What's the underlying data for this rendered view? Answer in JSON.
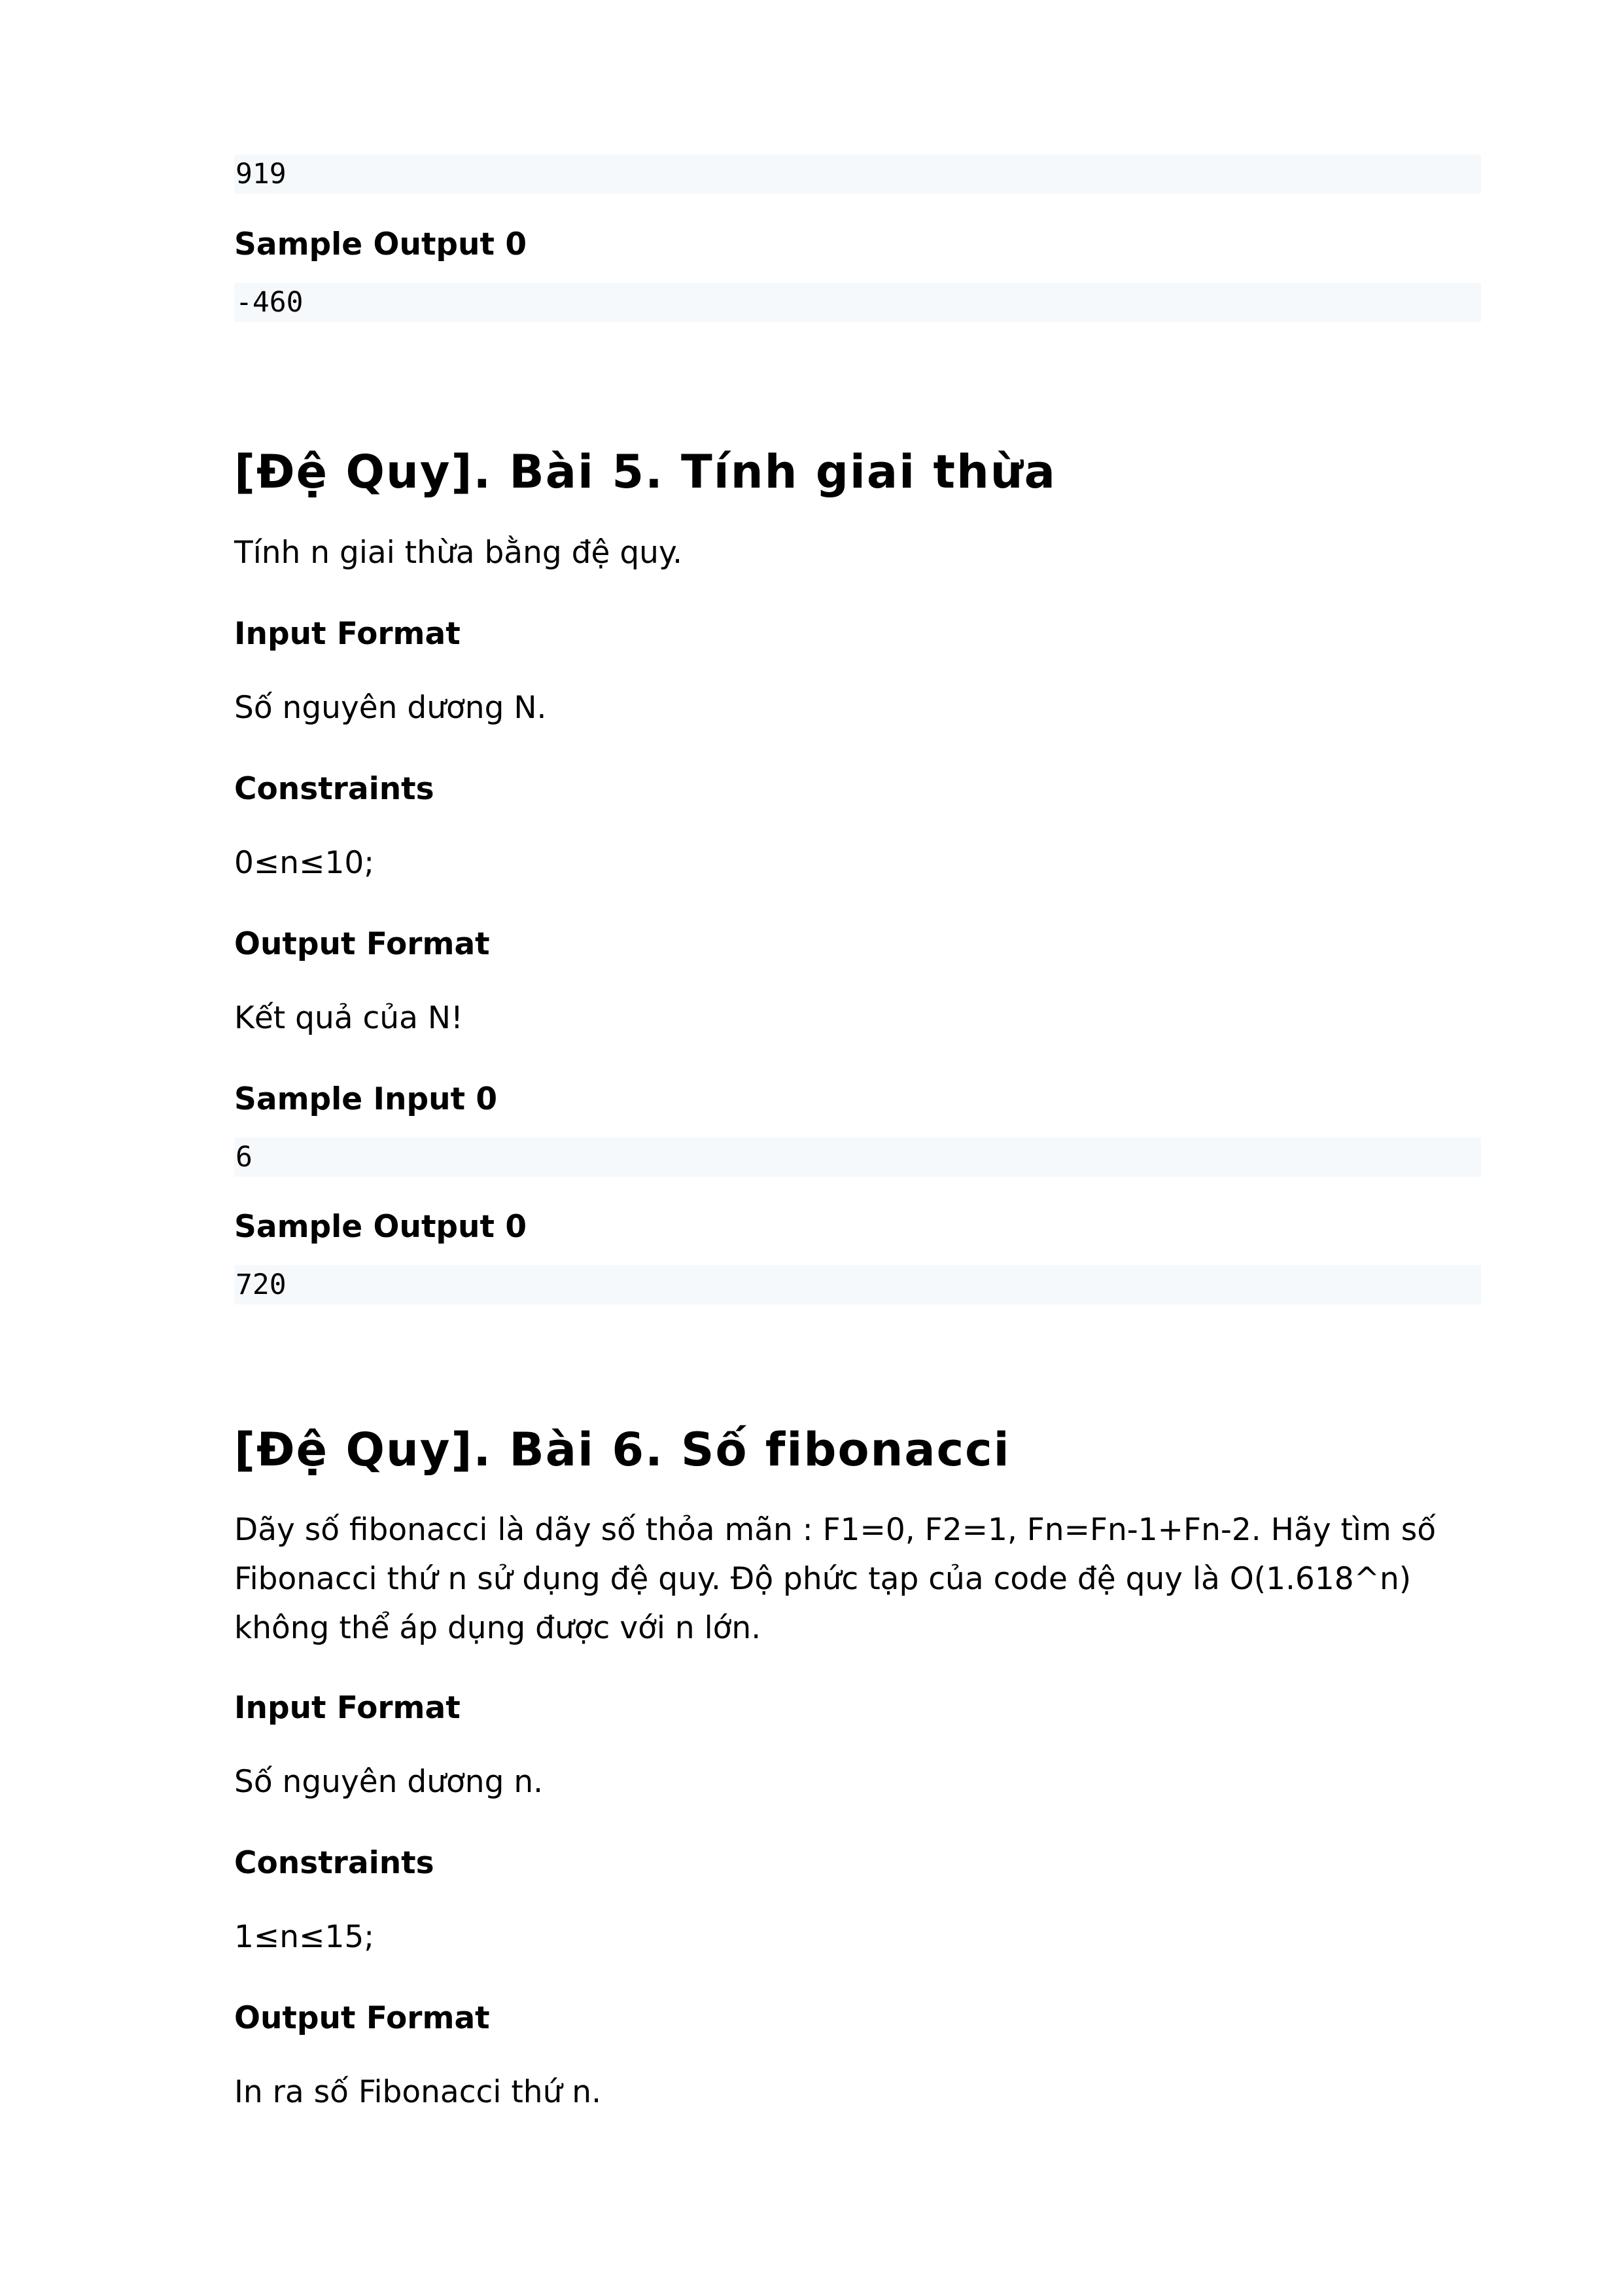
{
  "top_block": {
    "input_value": "919",
    "sample_output_label": "Sample Output 0",
    "sample_output_value": "-460"
  },
  "problem5": {
    "title": "[Đệ Quy]. Bài 5. Tính giai thừa",
    "description": "Tính n giai thừa bằng đệ quy.",
    "input_format_label": "Input Format",
    "input_format_text": "Số nguyên dương N.",
    "constraints_label": "Constraints",
    "constraints_text": "0≤n≤10;",
    "output_format_label": "Output Format",
    "output_format_text": "Kết quả của N!",
    "sample_input_label": "Sample Input 0",
    "sample_input_value": "6",
    "sample_output_label": "Sample Output 0",
    "sample_output_value": "720"
  },
  "problem6": {
    "title": "[Đệ Quy]. Bài 6. Số fibonacci",
    "description": "Dãy số fibonacci là dãy số thỏa mãn : F1=0, F2=1, Fn=Fn-1+Fn-2. Hãy tìm số Fibonacci thứ n sử dụng đệ quy. Độ phức tạp của code đệ quy là O(1.618^n) không thể áp dụng được với n lớn.",
    "input_format_label": "Input Format",
    "input_format_text": "Số nguyên dương n.",
    "constraints_label": "Constraints",
    "constraints_text": "1≤n≤15;",
    "output_format_label": "Output Format",
    "output_format_text": "In ra số Fibonacci thứ n."
  }
}
